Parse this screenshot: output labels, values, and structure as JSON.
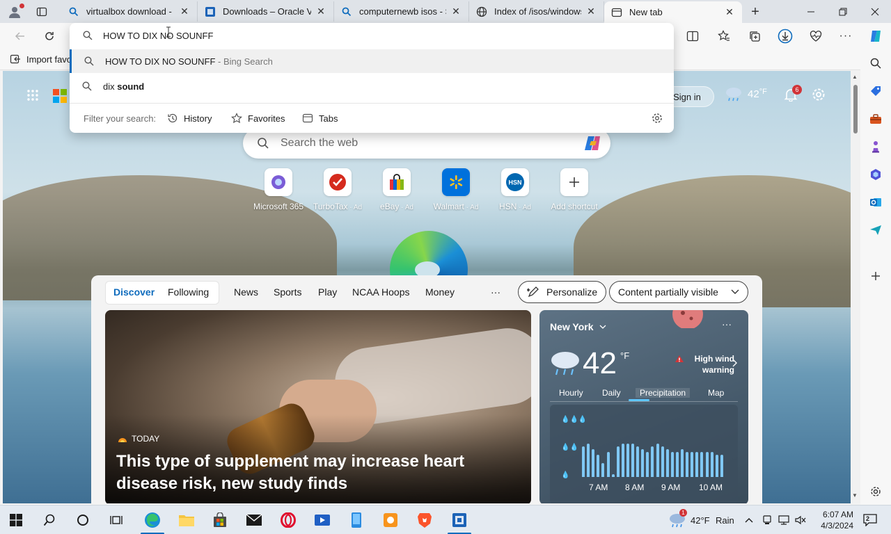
{
  "tabs": [
    {
      "label": "virtualbox download - Se",
      "icon": "search-icon"
    },
    {
      "label": "Downloads – Oracle VM",
      "icon": "virtualbox-icon"
    },
    {
      "label": "computernewb isos - Se",
      "icon": "search-icon"
    },
    {
      "label": "Index of /isos/windows/",
      "icon": "globe-icon"
    },
    {
      "label": "New tab",
      "icon": "newtab-icon",
      "active": true
    }
  ],
  "address_bar": {
    "value": "HOW TO DIX NO SOUNFF"
  },
  "suggestions": [
    {
      "main": "HOW TO DIX NO SOUNFF",
      "sub": " - Bing Search",
      "highlighted": true
    },
    {
      "prefix": "dix ",
      "bold": "sound"
    }
  ],
  "filter": {
    "label": "Filter your search:",
    "options": [
      "History",
      "Favorites",
      "Tabs"
    ]
  },
  "favorites_bar": {
    "import_label": "Import favo"
  },
  "ntp": {
    "sign_in": "Sign in",
    "weather_temp": "42",
    "weather_unit": "°F",
    "notification_count": "6",
    "search_placeholder": "Search the web",
    "shortcuts": [
      {
        "name": "Microsoft 365",
        "ad": ""
      },
      {
        "name": "TurboTax",
        "ad": " · Ad"
      },
      {
        "name": "eBay",
        "ad": " · Ad"
      },
      {
        "name": "Walmart",
        "ad": " · Ad"
      },
      {
        "name": "HSN",
        "ad": " · Ad"
      },
      {
        "name": "Add shortcut",
        "ad": ""
      }
    ]
  },
  "feed": {
    "tabs": [
      "Discover",
      "Following"
    ],
    "categories": [
      "News",
      "Sports",
      "Play",
      "NCAA Hoops",
      "Money"
    ],
    "more": "···",
    "personalize": "Personalize",
    "visibility": "Content partially visible",
    "hero": {
      "source": "TODAY",
      "headline": "This type of supplement may increase heart disease risk, new study finds"
    }
  },
  "weather_card": {
    "location": "New York",
    "more": "···",
    "temp": "42",
    "unit": "°F",
    "alert": "High wind warning",
    "tabs": [
      "Hourly",
      "Daily",
      "Precipitation",
      "Map"
    ],
    "selected_tab": "Precipitation",
    "time_labels": [
      "7 AM",
      "8 AM",
      "9 AM",
      "10 AM"
    ],
    "precip_levels": [
      0.55,
      0.6,
      0.5,
      0.4,
      0.25,
      0.45,
      0.05,
      0.55,
      0.6,
      0.6,
      0.6,
      0.55,
      0.5,
      0.45,
      0.55,
      0.6,
      0.55,
      0.5,
      0.45,
      0.45,
      0.5,
      0.45,
      0.45,
      0.45,
      0.45,
      0.45,
      0.45,
      0.4,
      0.4
    ]
  },
  "taskbar": {
    "weather": "42°F",
    "condition": "Rain",
    "weather_badge": "1",
    "time": "6:07 AM",
    "date": "4/3/2024",
    "notification_count": "2"
  },
  "colors": {
    "accent": "#0f6cbd",
    "alert": "#d13438",
    "precip_bar": "#80c8f4"
  }
}
